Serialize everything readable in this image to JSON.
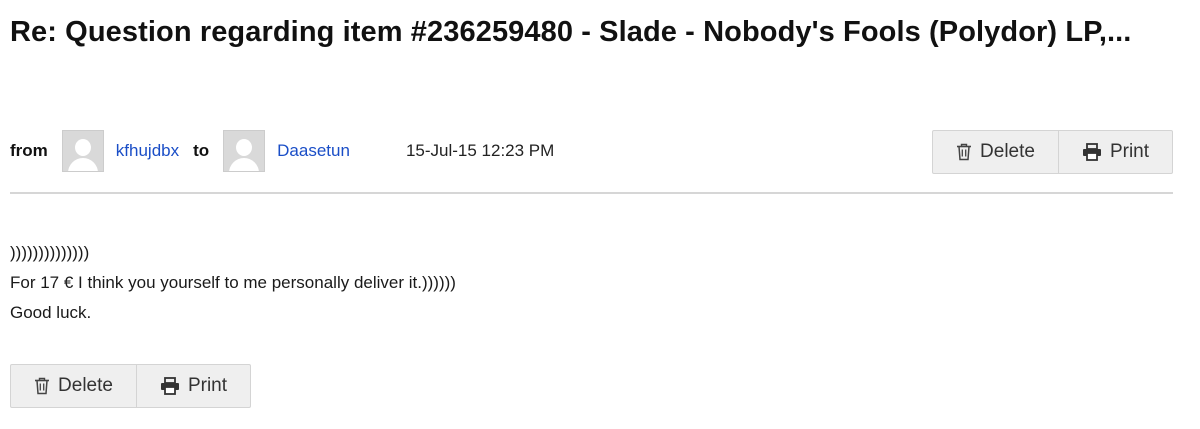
{
  "message": {
    "subject": "Re: Question regarding item #236259480 - Slade - Nobody's Fools (Polydor) LP,...",
    "from_label": "from",
    "sender": "kfhujdbx",
    "to_label": "to",
    "recipient": "Daasetun",
    "timestamp": "15-Jul-15 12:23 PM",
    "body_lines": [
      "))))))))))))))",
      "For 17 € I think you yourself to me personally deliver it.))))))",
      "Good luck."
    ]
  },
  "actions": {
    "delete_label": "Delete",
    "print_label": "Print"
  },
  "icons": {
    "avatar": "default-avatar-icon",
    "delete": "trash-icon",
    "print": "printer-icon"
  },
  "colors": {
    "link": "#1a4ec7",
    "button_bg": "#efefef",
    "divider": "#d6d6d6"
  }
}
